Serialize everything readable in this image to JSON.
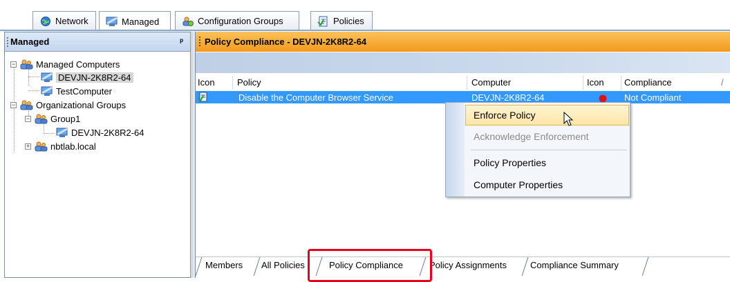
{
  "top_tabs": {
    "network": "Network",
    "managed": "Managed",
    "configuration_groups": "Configuration Groups",
    "policies": "Policies"
  },
  "left_panel": {
    "title": "Managed",
    "pin": "ᵖ",
    "tree": {
      "managed_computers": "Managed Computers",
      "computer_1": "DEVJN-2K8R2-64",
      "computer_2": "TestComputer",
      "organizational_groups": "Organizational Groups",
      "group1": "Group1",
      "group1_computer": "DEVJN-2K8R2-64",
      "domain": "nbtlab.local",
      "collapse_glyph": "−",
      "expand_glyph": "+"
    }
  },
  "right_panel": {
    "title": "Policy Compliance - DEVJN-2K8R2-64",
    "columns": {
      "icon": "Icon",
      "policy": "Policy",
      "computer": "Computer",
      "icon2": "Icon",
      "compliance": "Compliance",
      "extra": "/"
    },
    "row": {
      "policy": "Disable the Computer Browser Service",
      "computer": "DEVJN-2K8R2-64",
      "compliance": "Not Compliant"
    }
  },
  "context_menu": {
    "items": [
      "Enforce Policy",
      "Acknowledge Enforcement",
      "Policy Properties",
      "Computer Properties"
    ]
  },
  "bottom_tabs": [
    "Members",
    "All Policies",
    "Policy Compliance",
    "Policy Assignments",
    "Compliance Summary"
  ],
  "colors": {
    "header_orange": "#f39a1d",
    "selection_blue": "#3399ff",
    "highlight_red": "#e8001c",
    "status_icon_red": "#d9151b"
  }
}
